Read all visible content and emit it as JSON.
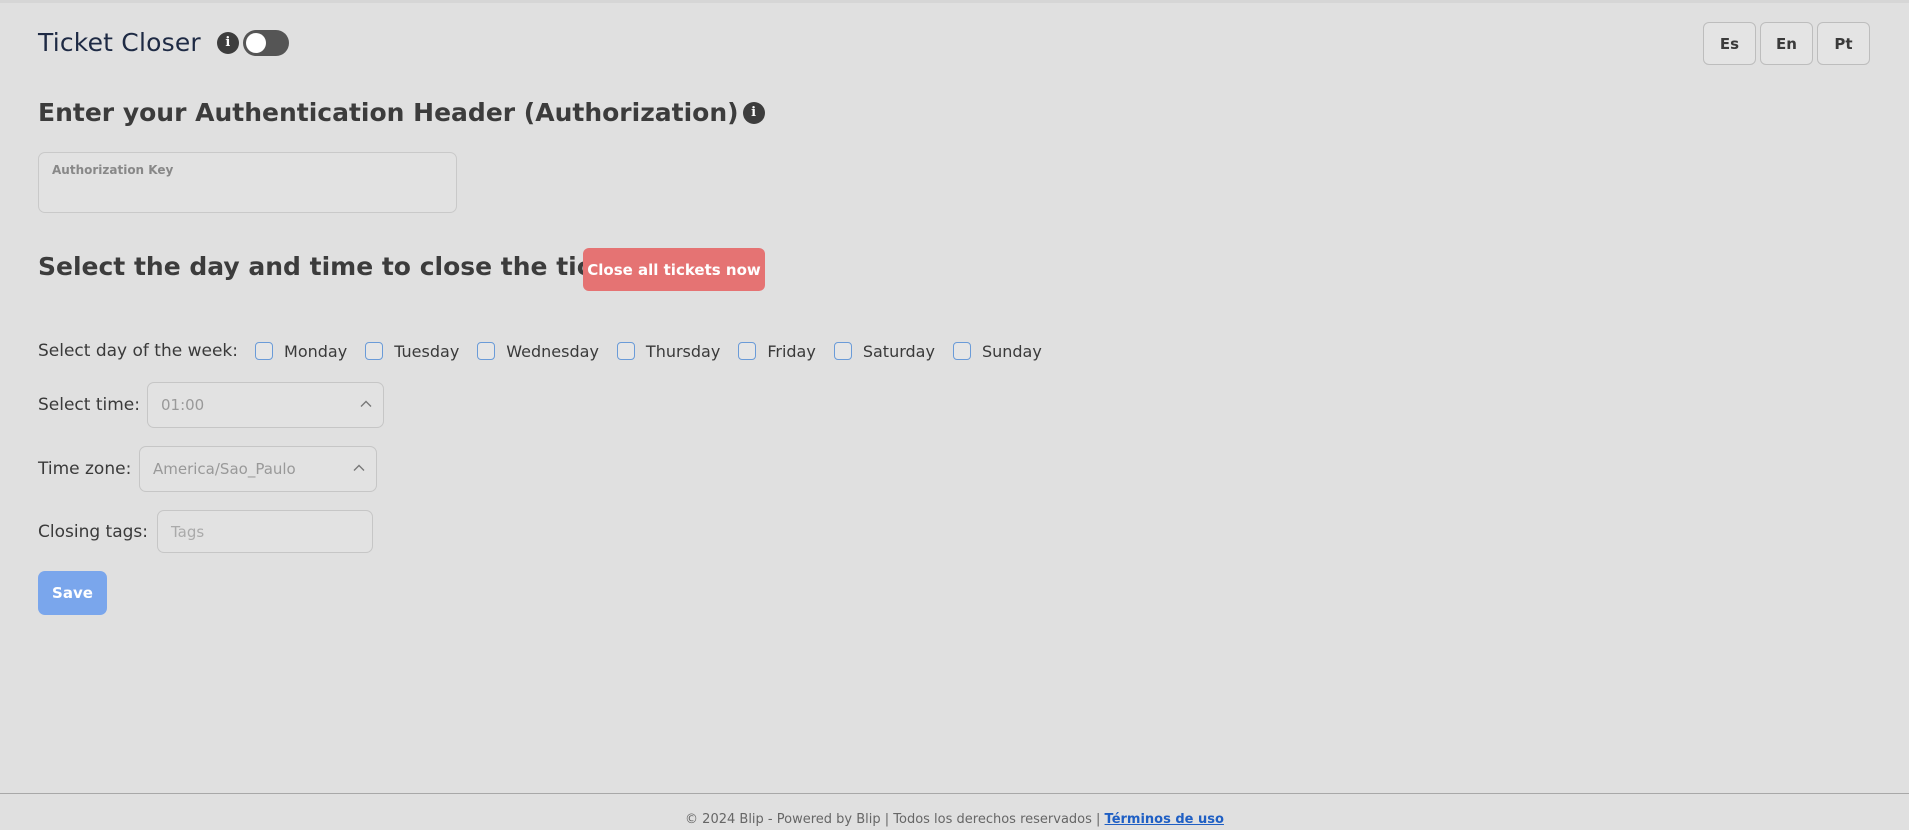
{
  "header": {
    "title": "Ticket Closer",
    "info_glyph": "i",
    "toggle_on": false
  },
  "languages": [
    "Es",
    "En",
    "Pt"
  ],
  "auth": {
    "heading": "Enter your Authentication Header (Authorization)",
    "info_glyph": "i",
    "field_label": "Authorization Key",
    "field_value": ""
  },
  "schedule": {
    "heading": "Select the day and time to close the tickets.",
    "close_now_label": "Close all tickets now",
    "days_label": "Select day of the week:",
    "days": [
      "Monday",
      "Tuesday",
      "Wednesday",
      "Thursday",
      "Friday",
      "Saturday",
      "Sunday"
    ],
    "time_label": "Select time:",
    "time_value": "01:00",
    "timezone_label": "Time zone:",
    "timezone_value": "America/Sao_Paulo",
    "tags_label": "Closing tags:",
    "tags_placeholder": "Tags",
    "save_label": "Save"
  },
  "footer": {
    "text": "© 2024 Blip - Powered by Blip | Todos los derechos reservados | ",
    "link_label": "Términos de uso"
  },
  "colors": {
    "background": "#e0e0e0",
    "danger": "#e57373",
    "primary": "#7aa6ec",
    "link": "#1f5fc4"
  },
  "icons": {
    "info": "info-icon",
    "chevron": "chevron-up-icon"
  }
}
